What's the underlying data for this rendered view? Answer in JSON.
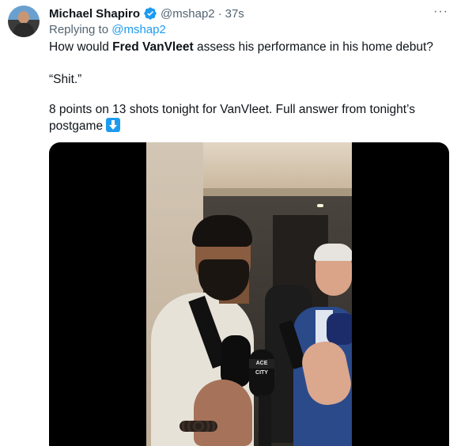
{
  "author": {
    "name": "Michael Shapiro",
    "handle": "@mshap2",
    "time": "37s",
    "separator": "·"
  },
  "reply": {
    "prefix": "Replying to",
    "handle": "@mshap2"
  },
  "tweet": {
    "line1_pre": "How would ",
    "line1_bold": "Fred VanVleet",
    "line1_post": " assess his performance in his home debut?",
    "line2": "“Shit.”",
    "line3": "8 points on 13 shots tonight for VanVleet. Full answer from tonight’s",
    "line4": "postgame"
  },
  "media": {
    "mic_label": "ACE CITY"
  },
  "menu": {
    "more_label": "···"
  },
  "icons": {
    "verified": "verified-badge-icon",
    "more": "more-options-icon",
    "arrow": "down-arrow-emoji-icon"
  },
  "colors": {
    "link": "#1d9bf0",
    "secondary_text": "#536471",
    "primary_text": "#0f1419"
  }
}
